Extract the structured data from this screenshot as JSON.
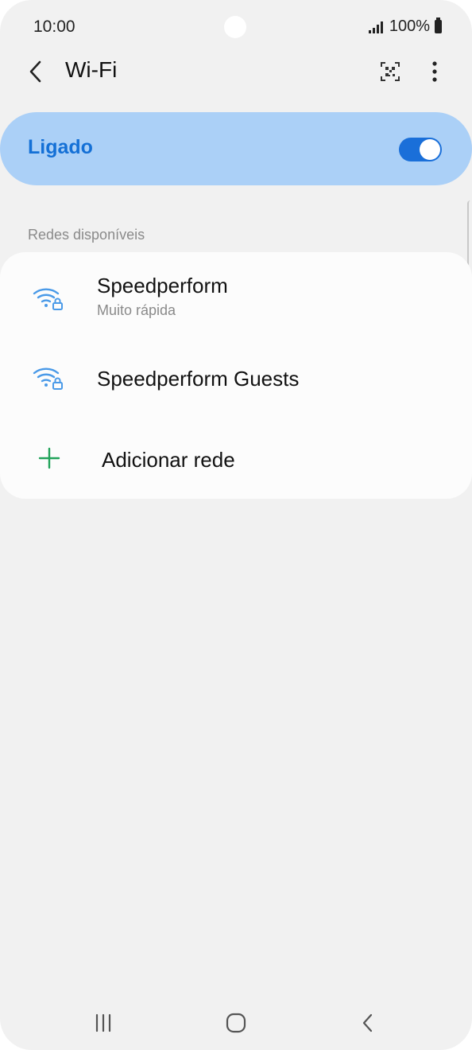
{
  "status_bar": {
    "time": "10:00",
    "battery_text": "100%"
  },
  "app_bar": {
    "title": "Wi-Fi",
    "icons": [
      "back-icon",
      "qr-code-icon",
      "more-options-icon"
    ]
  },
  "wifi_toggle": {
    "label": "Ligado",
    "state": "on"
  },
  "section": {
    "header": "Redes disponíveis"
  },
  "networks": [
    {
      "name": "Speedperform",
      "status": "Muito rápida",
      "icon": "wifi-locked-icon"
    },
    {
      "name": "Speedperform Guests",
      "icon": "wifi-locked-icon"
    }
  ],
  "add_network": {
    "label": "Adicionar rede",
    "icon": "plus-icon"
  },
  "navigation": {
    "icons": [
      "recent-apps-icon",
      "home-icon",
      "back-nav-icon"
    ]
  },
  "colors": {
    "accent": "#1a6fd9",
    "toggle_bar_bg": "#abd0f7",
    "wifi_icon": "#4a9ae8",
    "add_icon": "#21a35a"
  }
}
